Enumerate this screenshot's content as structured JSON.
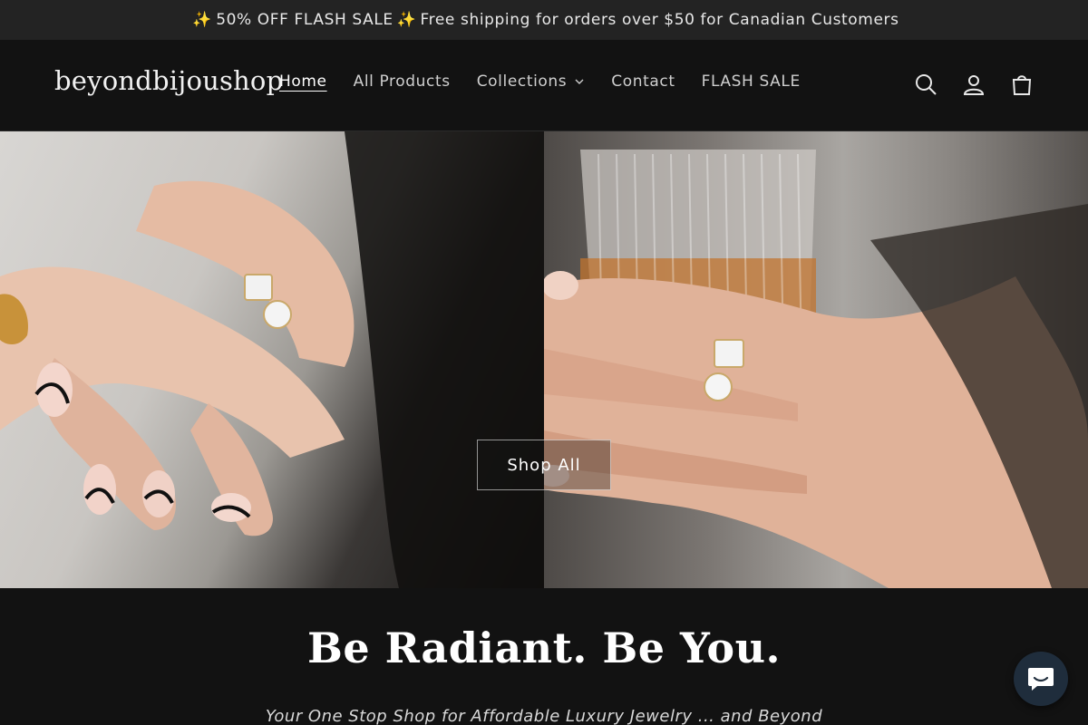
{
  "announcement": {
    "spark": "✨",
    "text_a": "50% OFF FLASH SALE",
    "text_b": "Free shipping for orders over $50 for Canadian Customers"
  },
  "header": {
    "logo": "beyondbijoushop",
    "nav": [
      "Home",
      "All Products",
      "Collections",
      "Contact",
      "FLASH SALE"
    ],
    "icons": [
      "search-icon",
      "account-icon",
      "cart-icon"
    ]
  },
  "hero": {
    "cta": "Shop All"
  },
  "intro": {
    "title": "Be Radiant. Be You.",
    "subtitle": "Your One Stop Shop for Affordable Luxury Jewelry ... and Beyond"
  },
  "chat": {
    "icon": "chat-icon"
  },
  "colors": {
    "background": "#121212",
    "announcement_bg": "#232323",
    "chat_bg": "#1f2d3c"
  }
}
